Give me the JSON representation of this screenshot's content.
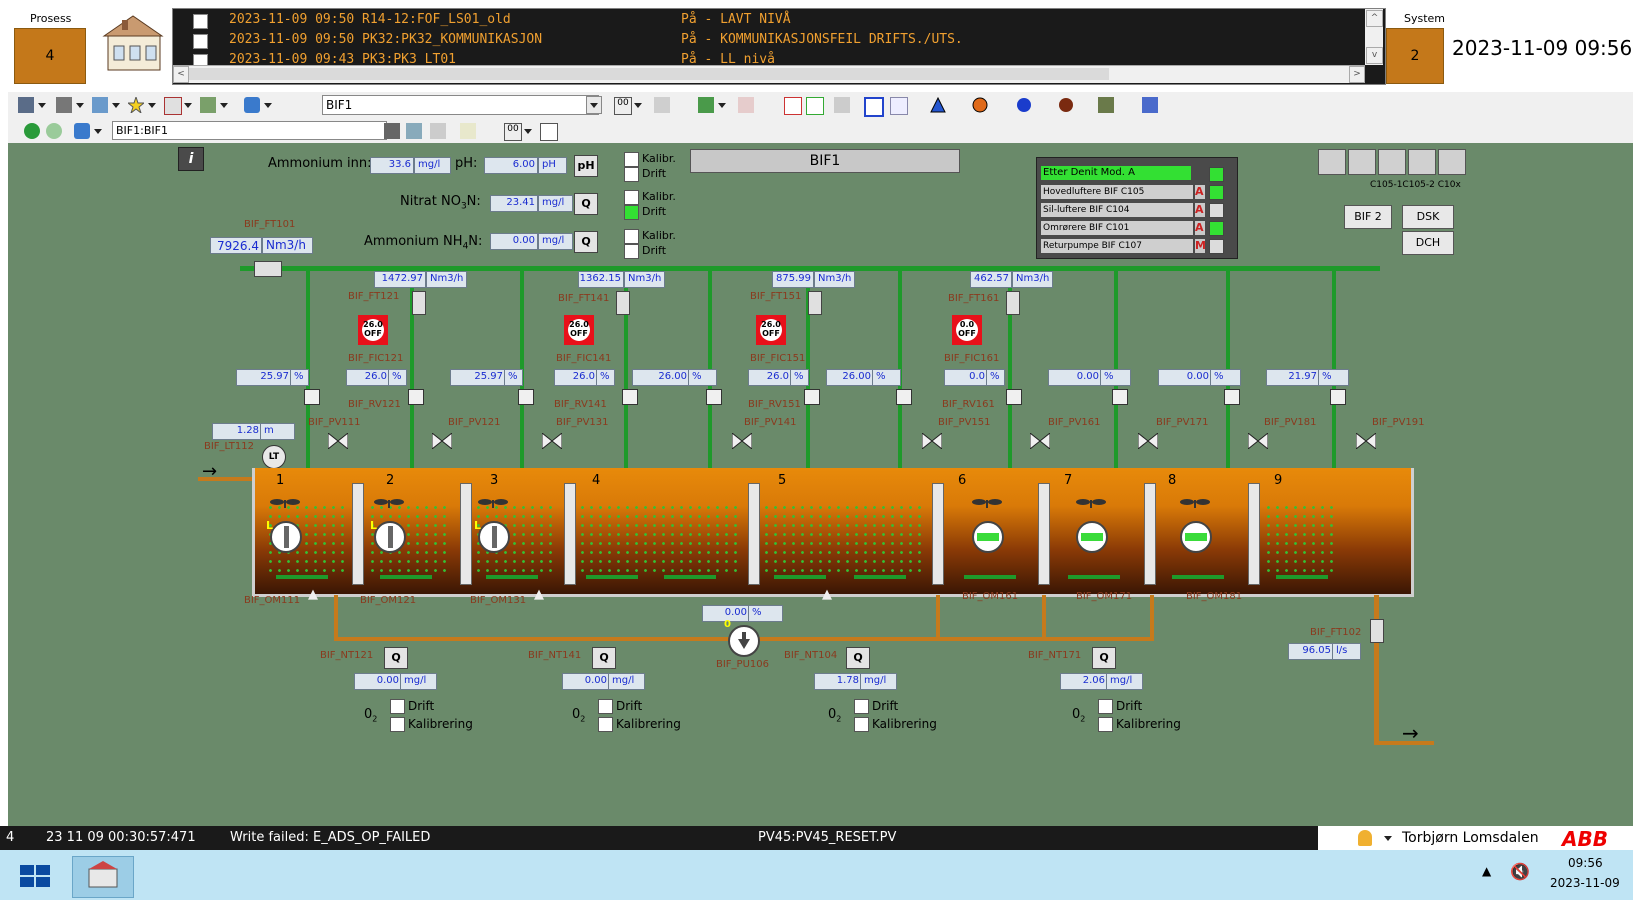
{
  "topbar": {
    "process_label": "Prosess",
    "process_count": "4",
    "system_label": "System",
    "system_count": "2",
    "datetime": "2023-11-09 09:56"
  },
  "alarms": [
    {
      "time_tag": "2023-11-09 09:50 R14-12:FOF_LS01_old",
      "message": "På - LAVT NIVÅ"
    },
    {
      "time_tag": "2023-11-09 09:50 PK32:PK32_KOMMUNIKASJON",
      "message": "På - KOMMUNIKASJONSFEIL DRIFTS./UTS."
    },
    {
      "time_tag": "2023-11-09 09:43 PK3:PK3_LT01",
      "message": "På - LL nivå"
    }
  ],
  "toolbar1": {
    "combo_value": "BIF1"
  },
  "toolbar2": {
    "address_value": "BIF1:BIF1"
  },
  "plant": {
    "info_icon": "i",
    "title": "BIF1",
    "ammonium_inn_label": "Ammonium inn:",
    "ammonium_inn_value": "33.6",
    "ammonium_inn_unit": "mg/l",
    "ph_label": "pH:",
    "ph_value": "6.00",
    "ph_unit": "pH",
    "ph_button": "pH",
    "nitrat_label_a": "Nitrat NO",
    "nitrat_sub": "3",
    "nitrat_label_b": "N:",
    "nitrat_value": "23.41",
    "nitrat_unit": "mg/l",
    "ammonium_nh4_label_a": "Ammonium NH",
    "ammonium_nh4_sub": "4",
    "ammonium_nh4_label_b": "N:",
    "ammonium_nh4_value": "0.00",
    "ammonium_nh4_unit": "mg/l",
    "q": "Q",
    "kalibr": "Kalibr.",
    "drift": "Drift",
    "ft101_tag": "BIF_FT101",
    "ft101_value": "7926.4",
    "ft101_unit": "Nm3/h",
    "lt112_tag": "BIF_LT112",
    "lt112_value": "1.28",
    "lt112_unit": "m",
    "lt_symbol": "LT",
    "ft102_tag": "BIF_FT102",
    "ft102_value": "96.05",
    "ft102_unit": "l/s",
    "pu106_tag": "BIF_PU106",
    "pu106_value": "0.00",
    "pu106_unit": "%",
    "pu106_state": "0",
    "mixer_mode": "L"
  },
  "flows": [
    {
      "value": "1472.97",
      "unit": "Nm3/h",
      "ft": "BIF_FT121",
      "fic": "BIF_FIC121",
      "rv": "BIF_RV121",
      "sp": "26.0",
      "state": "OFF",
      "out": "26.0",
      "out_unit": "%"
    },
    {
      "value": "1362.15",
      "unit": "Nm3/h",
      "ft": "BIF_FT141",
      "fic": "BIF_FIC141",
      "rv": "BIF_RV141",
      "sp": "26.0",
      "state": "OFF",
      "out": "26.0",
      "out_unit": "%"
    },
    {
      "value": "875.99",
      "unit": "Nm3/h",
      "ft": "BIF_FT151",
      "fic": "BIF_FIC151",
      "rv": "BIF_RV151",
      "sp": "26.0",
      "state": "OFF",
      "out": "26.0",
      "out_unit": "%"
    },
    {
      "value": "462.57",
      "unit": "Nm3/h",
      "ft": "BIF_FT161",
      "fic": "BIF_FIC161",
      "rv": "BIF_RV161",
      "sp": "0.0",
      "state": "OFF",
      "out": "0.0",
      "out_unit": "%"
    }
  ],
  "valve_pct": [
    {
      "value": "25.97",
      "unit": "%"
    },
    {
      "value": "25.97",
      "unit": "%"
    },
    {
      "value": "26.00",
      "unit": "%"
    },
    {
      "value": "26.00",
      "unit": "%"
    },
    {
      "value": "0.00",
      "unit": "%"
    },
    {
      "value": "0.00",
      "unit": "%"
    },
    {
      "value": "21.97",
      "unit": "%"
    }
  ],
  "pv_tags": [
    "BIF_PV111",
    "BIF_PV121",
    "BIF_PV131",
    "BIF_PV141",
    "BIF_PV151",
    "BIF_PV161",
    "BIF_PV171",
    "BIF_PV181",
    "BIF_PV191"
  ],
  "sections": [
    "1",
    "2",
    "3",
    "4",
    "5",
    "6",
    "7",
    "8",
    "9"
  ],
  "mixers": [
    "BIF_OM111",
    "BIF_OM121",
    "BIF_OM131",
    "BIF_OM161",
    "BIF_OM171",
    "BIF_OM181"
  ],
  "analyzers": [
    {
      "tag": "BIF_NT121",
      "value": "0.00",
      "unit": "mg/l",
      "o2": "0",
      "o2_sub": "2",
      "drift": "Drift",
      "kal": "Kalibrering"
    },
    {
      "tag": "BIF_NT141",
      "value": "0.00",
      "unit": "mg/l",
      "o2": "0",
      "o2_sub": "2",
      "drift": "Drift",
      "kal": "Kalibrering"
    },
    {
      "tag": "BIF_NT104",
      "value": "1.78",
      "unit": "mg/l",
      "o2": "0",
      "o2_sub": "2",
      "drift": "Drift",
      "kal": "Kalibrering"
    },
    {
      "tag": "BIF_NT171",
      "value": "2.06",
      "unit": "mg/l",
      "o2": "0",
      "o2_sub": "2",
      "drift": "Drift",
      "kal": "Kalibrering"
    }
  ],
  "mode_panel": {
    "title": "Etter Denit Mod. A",
    "rows": [
      {
        "label": "Hovedluftere BIF C105",
        "mode": "A",
        "on": true
      },
      {
        "label": "Sil-luftere BIF C104",
        "mode": "A",
        "on": false
      },
      {
        "label": "Omrørere BIF C101",
        "mode": "A",
        "on": true
      },
      {
        "label": "Returpumpe BIF C107",
        "mode": "M",
        "on": false
      }
    ]
  },
  "nav": {
    "bif2": "BIF 2",
    "dsk": "DSK",
    "dch": "DCH",
    "labels": "C105-1C105-2  C10x"
  },
  "status": {
    "count": "4",
    "time": "23 11 09 00:30:57:471",
    "message": "Write failed: E_ADS_OP_FAILED",
    "tag": "PV45:PV45_RESET.PV",
    "user": "Torbjørn Lomsdalen",
    "logo": "ABB"
  },
  "taskbar": {
    "time": "09:56",
    "date": "2023-11-09"
  },
  "colors": {
    "pipe_green": "#1e9a2a",
    "pipe_orange": "#c67a1c",
    "canvas": "#6a8a6a",
    "alarm_text": "#f0a030",
    "off_red": "#e8101a"
  }
}
